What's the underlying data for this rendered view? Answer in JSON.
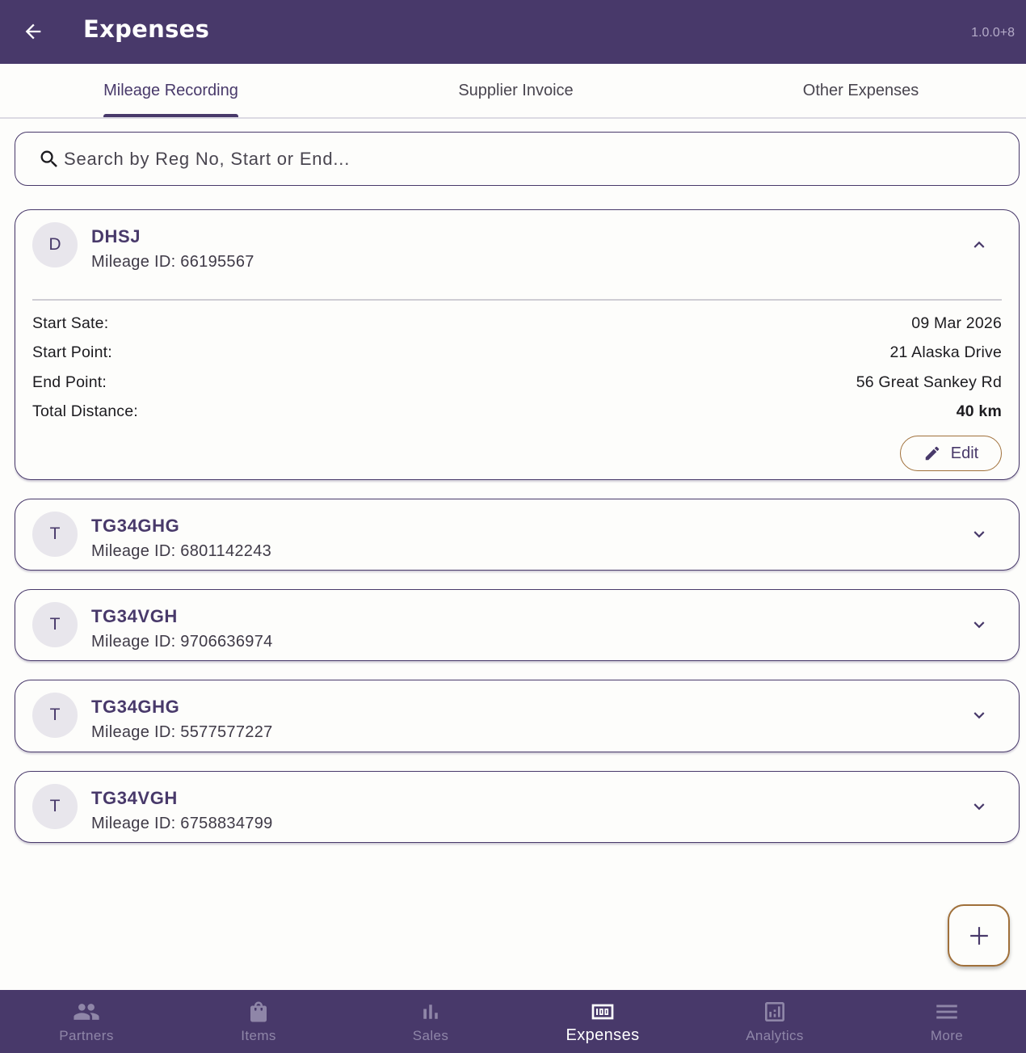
{
  "appbar": {
    "title": "Expenses",
    "version": "1.0.0+8"
  },
  "tabs": [
    {
      "label": "Mileage Recording",
      "active": true
    },
    {
      "label": "Supplier Invoice",
      "active": false
    },
    {
      "label": "Other Expenses",
      "active": false
    }
  ],
  "search": {
    "placeholder": "Search by Reg No, Start or End...",
    "value": ""
  },
  "details_labels": {
    "start_date": "Start Sate:",
    "start_point": "Start Point:",
    "end_point": "End Point:",
    "total_distance": "Total Distance:",
    "edit": "Edit"
  },
  "records": [
    {
      "initial": "D",
      "reg_no": "DHSJ",
      "mileage_id": "Mileage ID: 66195567",
      "expanded": true,
      "start_date": "09 Mar 2026",
      "start_point": "21 Alaska Drive",
      "end_point": "56 Great Sankey Rd",
      "total_distance": "40 km"
    },
    {
      "initial": "T",
      "reg_no": "TG34GHG",
      "mileage_id": "Mileage ID: 6801142243",
      "expanded": false
    },
    {
      "initial": "T",
      "reg_no": "TG34VGH",
      "mileage_id": "Mileage ID: 9706636974",
      "expanded": false
    },
    {
      "initial": "T",
      "reg_no": "TG34GHG",
      "mileage_id": "Mileage ID: 5577577227",
      "expanded": false
    },
    {
      "initial": "T",
      "reg_no": "TG34VGH",
      "mileage_id": "Mileage ID: 6758834799",
      "expanded": false
    }
  ],
  "bottom_nav": [
    {
      "label": "Partners",
      "icon": "people-icon",
      "active": false
    },
    {
      "label": "Items",
      "icon": "shopping-bag-icon",
      "active": false
    },
    {
      "label": "Sales",
      "icon": "bar-chart-icon",
      "active": false
    },
    {
      "label": "Expenses",
      "icon": "money-icon",
      "active": true
    },
    {
      "label": "Analytics",
      "icon": "analytics-icon",
      "active": false
    },
    {
      "label": "More",
      "icon": "menu-icon",
      "active": false
    }
  ],
  "colors": {
    "primary": "#48396a",
    "accent_outline": "#a0703a",
    "background": "#fdfdfb"
  }
}
